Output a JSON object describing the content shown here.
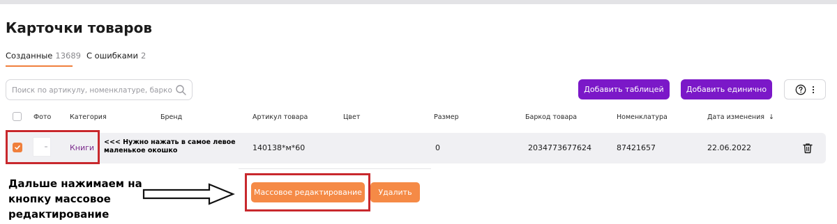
{
  "page": {
    "title": "Карточки товаров"
  },
  "tabs": [
    {
      "label": "Созданные",
      "count": "13689"
    },
    {
      "label": "С ошибками",
      "count": "2"
    }
  ],
  "search": {
    "placeholder": "Поиск по артикулу, номенклатуре, баркоду"
  },
  "actions": {
    "add_table": "Добавить таблицей",
    "add_single": "Добавить единично"
  },
  "table": {
    "columns": [
      "Фото",
      "Категория",
      "Бренд",
      "Артикул товара",
      "Цвет",
      "Размер",
      "Баркод товара",
      "Номенклатура",
      "Дата изменения"
    ],
    "sort_indicator": "↓",
    "rows": [
      {
        "checked": true,
        "category": "Книги",
        "brand": "",
        "article": "140138*м*60",
        "color": "",
        "size": "0",
        "barcode": "2034773677624",
        "nomenclature": "87421657",
        "date": "22.06.2022"
      }
    ]
  },
  "bulk": {
    "edit_label": "Массовое редактирование",
    "delete_label": "Удалить"
  },
  "annotations": {
    "row_hint": "<<< Нужно нажать в самое левое маленькое окошко",
    "instruction": "Дальше нажимаем на кнопку массовое редактирование"
  },
  "colors": {
    "accent_purple": "#7b18c8",
    "accent_orange": "#f58a46",
    "highlight_red": "#c8282d",
    "tab_underline": "#f07f3c",
    "row_background": "#f0f0f3"
  },
  "icons": {
    "search": "search-icon",
    "help": "help-circle-icon",
    "more": "more-vertical-icon",
    "delete": "trash-icon",
    "checkbox": "checkmark-icon",
    "sort": "arrow-down-icon",
    "pointer": "arrow-right-icon"
  }
}
